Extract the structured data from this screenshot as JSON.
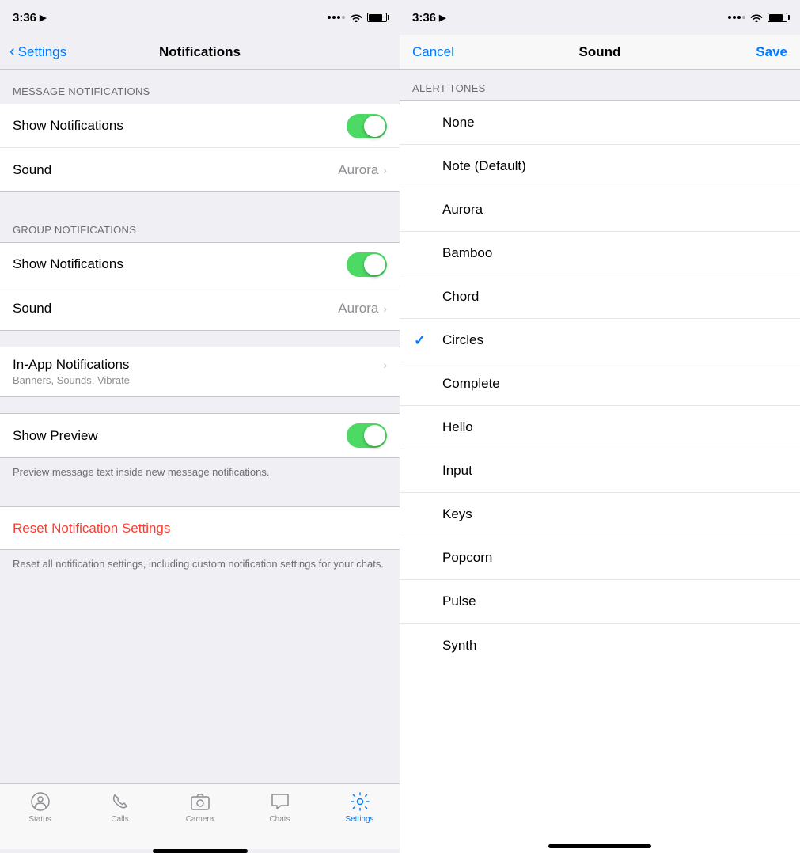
{
  "left": {
    "statusBar": {
      "time": "3:36",
      "locationIcon": "▲"
    },
    "navBar": {
      "backLabel": "Settings",
      "title": "Notifications"
    },
    "sections": {
      "messageNotifications": {
        "header": "MESSAGE NOTIFICATIONS",
        "showNotifications": {
          "label": "Show Notifications",
          "toggleOn": true
        },
        "sound": {
          "label": "Sound",
          "value": "Aurora"
        }
      },
      "groupNotifications": {
        "header": "GROUP NOTIFICATIONS",
        "showNotifications": {
          "label": "Show Notifications",
          "toggleOn": true
        },
        "sound": {
          "label": "Sound",
          "value": "Aurora"
        }
      },
      "inAppNotifications": {
        "label": "In-App Notifications",
        "subtitle": "Banners, Sounds, Vibrate"
      },
      "showPreview": {
        "label": "Show Preview",
        "toggleOn": true,
        "description": "Preview message text inside new message notifications."
      },
      "reset": {
        "label": "Reset Notification Settings",
        "description": "Reset all notification settings, including custom notification settings for your chats."
      }
    },
    "tabBar": {
      "items": [
        {
          "label": "Status",
          "icon": "status"
        },
        {
          "label": "Calls",
          "icon": "calls"
        },
        {
          "label": "Camera",
          "icon": "camera"
        },
        {
          "label": "Chats",
          "icon": "chats"
        },
        {
          "label": "Settings",
          "icon": "settings",
          "active": true
        }
      ]
    }
  },
  "right": {
    "statusBar": {
      "time": "3:36",
      "locationIcon": "▲"
    },
    "navBar": {
      "cancelLabel": "Cancel",
      "title": "Sound",
      "saveLabel": "Save"
    },
    "alertTonesHeader": "ALERT TONES",
    "soundItems": [
      {
        "label": "None",
        "checked": false
      },
      {
        "label": "Note (Default)",
        "checked": false
      },
      {
        "label": "Aurora",
        "checked": false
      },
      {
        "label": "Bamboo",
        "checked": false
      },
      {
        "label": "Chord",
        "checked": false
      },
      {
        "label": "Circles",
        "checked": true
      },
      {
        "label": "Complete",
        "checked": false
      },
      {
        "label": "Hello",
        "checked": false
      },
      {
        "label": "Input",
        "checked": false
      },
      {
        "label": "Keys",
        "checked": false
      },
      {
        "label": "Popcorn",
        "checked": false
      },
      {
        "label": "Pulse",
        "checked": false
      },
      {
        "label": "Synth",
        "checked": false
      }
    ]
  }
}
